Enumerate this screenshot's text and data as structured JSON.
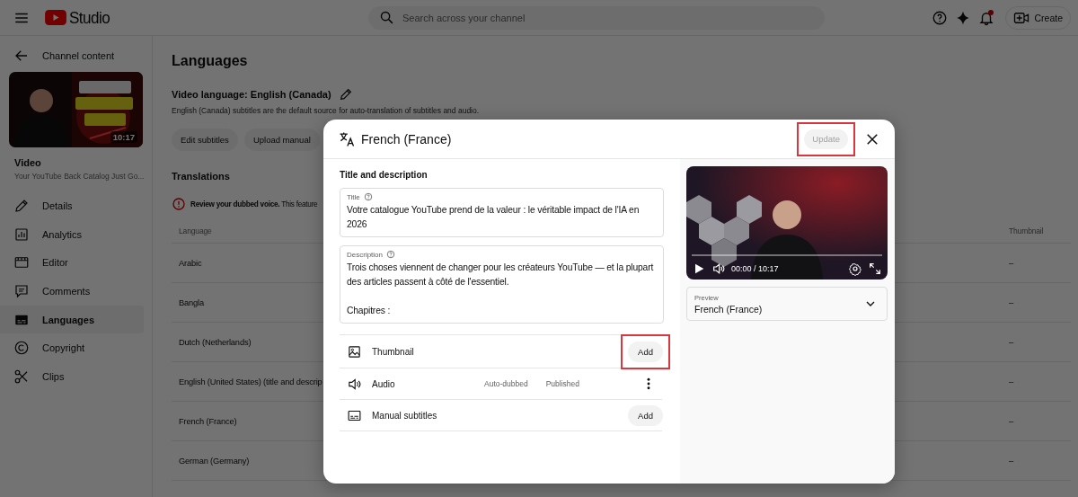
{
  "header": {
    "logo_text": "Studio",
    "search_placeholder": "Search across your channel",
    "notification_dot": true,
    "create_label": "Create"
  },
  "sidebar": {
    "back_label": "Channel content",
    "thumbnail_duration": "10:17",
    "video_label": "Video",
    "video_title": "Your YouTube Back Catalog Just Go...",
    "items": [
      {
        "kind": "details",
        "label": "Details",
        "selected": false
      },
      {
        "kind": "analytics",
        "label": "Analytics",
        "selected": false
      },
      {
        "kind": "editor",
        "label": "Editor",
        "selected": false
      },
      {
        "kind": "comments",
        "label": "Comments",
        "selected": false
      },
      {
        "kind": "languages",
        "label": "Languages",
        "selected": true
      },
      {
        "kind": "copyright",
        "label": "Copyright",
        "selected": false
      },
      {
        "kind": "clips",
        "label": "Clips",
        "selected": false
      }
    ]
  },
  "page": {
    "title": "Languages",
    "video_language": "Video language: English (Canada)",
    "note": "English (Canada) subtitles are the default source for auto-translation of subtitles and audio.",
    "buttons": [
      "Edit subtitles",
      "Upload manual"
    ],
    "translations_heading": "Translations",
    "alert": "**Review your dubbed voice.** This feature",
    "table": {
      "columns": [
        "Language",
        "Thumbnail"
      ],
      "rows": [
        {
          "language": "Arabic",
          "thumbnail": "–"
        },
        {
          "language": "Bangla",
          "thumbnail": "–"
        },
        {
          "language": "Dutch (Netherlands)",
          "thumbnail": "–"
        },
        {
          "language": "English (United States) (title and descrip",
          "thumbnail": "–"
        },
        {
          "language": "French (France)",
          "thumbnail": "–"
        },
        {
          "language": "German (Germany)",
          "thumbnail": "–"
        }
      ]
    }
  },
  "dialog": {
    "title": "French (France)",
    "update": {
      "label": "Update",
      "disabled": true,
      "highlighted": true
    },
    "section_heading": "Title and description",
    "title_field": {
      "label": "Title",
      "value": "Votre catalogue YouTube prend de la valeur : le véritable impact de l'IA en 2026"
    },
    "description_field": {
      "label": "Description",
      "value": "Trois choses viennent de changer pour les créateurs YouTube — et la plupart des articles passent à côté de l'essentiel.\n\nChapitres :"
    },
    "assets": [
      {
        "kind": "thumbnail",
        "label": "Thumbnail",
        "action": "Add",
        "highlighted": true
      },
      {
        "kind": "audio",
        "label": "Audio",
        "source": "Auto-dubbed",
        "status": "Published"
      },
      {
        "kind": "subtitles",
        "label": "Manual subtitles",
        "action": "Add",
        "highlighted": false
      }
    ],
    "player": {
      "time": "00:00 / 10:17"
    },
    "preview": {
      "label": "Preview",
      "value": "French (France)"
    }
  }
}
